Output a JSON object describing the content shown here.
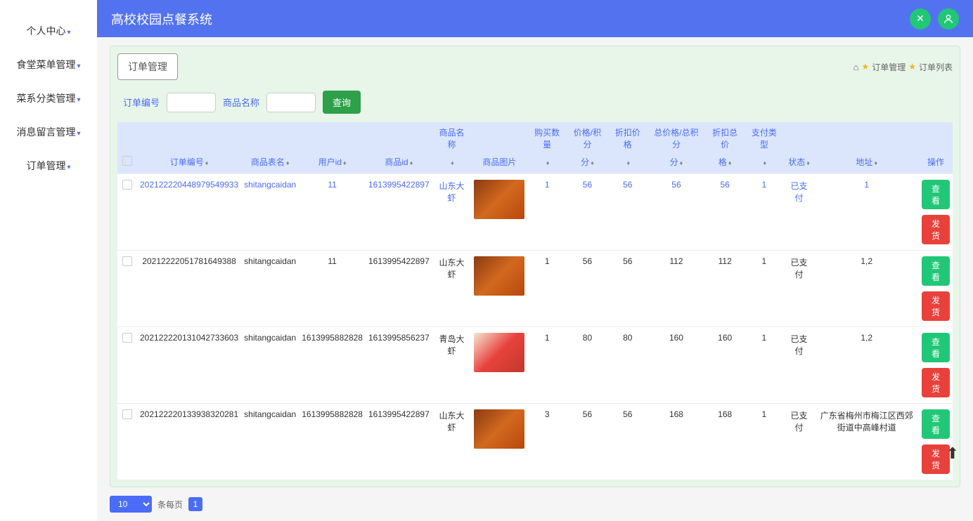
{
  "header": {
    "title": "高校校园点餐系统"
  },
  "sidebar": {
    "items": [
      {
        "label": "个人中心"
      },
      {
        "label": "食堂菜单管理"
      },
      {
        "label": "菜系分类管理"
      },
      {
        "label": "消息留言管理"
      },
      {
        "label": "订单管理"
      }
    ]
  },
  "page": {
    "badge": "订单管理",
    "crumb1": "订单管理",
    "crumb2": "订单列表"
  },
  "search": {
    "label_order_no": "订单编号",
    "label_product_name": "商品名称",
    "query": "查询"
  },
  "table": {
    "headers_top": {
      "product_name": "商品名称",
      "buy_qty": "购买数量",
      "price_per": "价格/积分",
      "discount_price": "折扣价格",
      "total_price": "总价格/总积分",
      "discount_total": "折扣总价",
      "pay_type": "支付类型"
    },
    "headers_sub": {
      "checkbox": "",
      "order_no": "订单编号",
      "product_table": "商品表名",
      "user_id": "用户id",
      "product_id": "商品id",
      "product_img": "商品图片",
      "status": "状态",
      "address": "地址",
      "op": "操作"
    },
    "rows": [
      {
        "order_no": "20212222044897954993",
        "product_table": "shitangcaidan",
        "user_id": "11",
        "product_id": "1613995422897",
        "product_name": "山东大虾",
        "img": "a",
        "qty": "1",
        "price": "56",
        "discount": "56",
        "total": "56",
        "d_total": "56",
        "pay": "1",
        "status": "已支付",
        "address": "1"
      },
      {
        "order_no": "20212222051781649388",
        "product_table": "shitangcaidan",
        "user_id": "11",
        "product_id": "1613995422897",
        "product_name": "山东大虾",
        "img": "a",
        "qty": "1",
        "price": "56",
        "discount": "56",
        "total": "112",
        "d_total": "112",
        "pay": "1",
        "status": "已支付",
        "address": "1,2"
      },
      {
        "order_no": "20212222013104273360",
        "product_table": "shitangcaidan",
        "user_id": "1613995882828",
        "product_id": "1613995856237",
        "product_name": "青岛大虾",
        "img": "b",
        "qty": "1",
        "price": "80",
        "discount": "80",
        "total": "160",
        "d_total": "160",
        "pay": "1",
        "status": "已支付",
        "address": "1,2"
      },
      {
        "order_no": "20212222013393832028",
        "product_table": "shitangcaidan",
        "user_id": "1613995882828",
        "product_id": "1613995422897",
        "product_name": "山东大虾",
        "img": "a",
        "qty": "3",
        "price": "56",
        "discount": "56",
        "total": "168",
        "d_total": "168",
        "pay": "1",
        "status": "已支付",
        "address": "广东省梅州市梅江区西郊街道中高峰村道"
      }
    ],
    "row_order_suffix": [
      "3",
      "",
      "3",
      "1"
    ],
    "btn_view": "查看",
    "btn_ship": "发货"
  },
  "pager": {
    "size": "10",
    "label": "条每页",
    "page": "1"
  }
}
